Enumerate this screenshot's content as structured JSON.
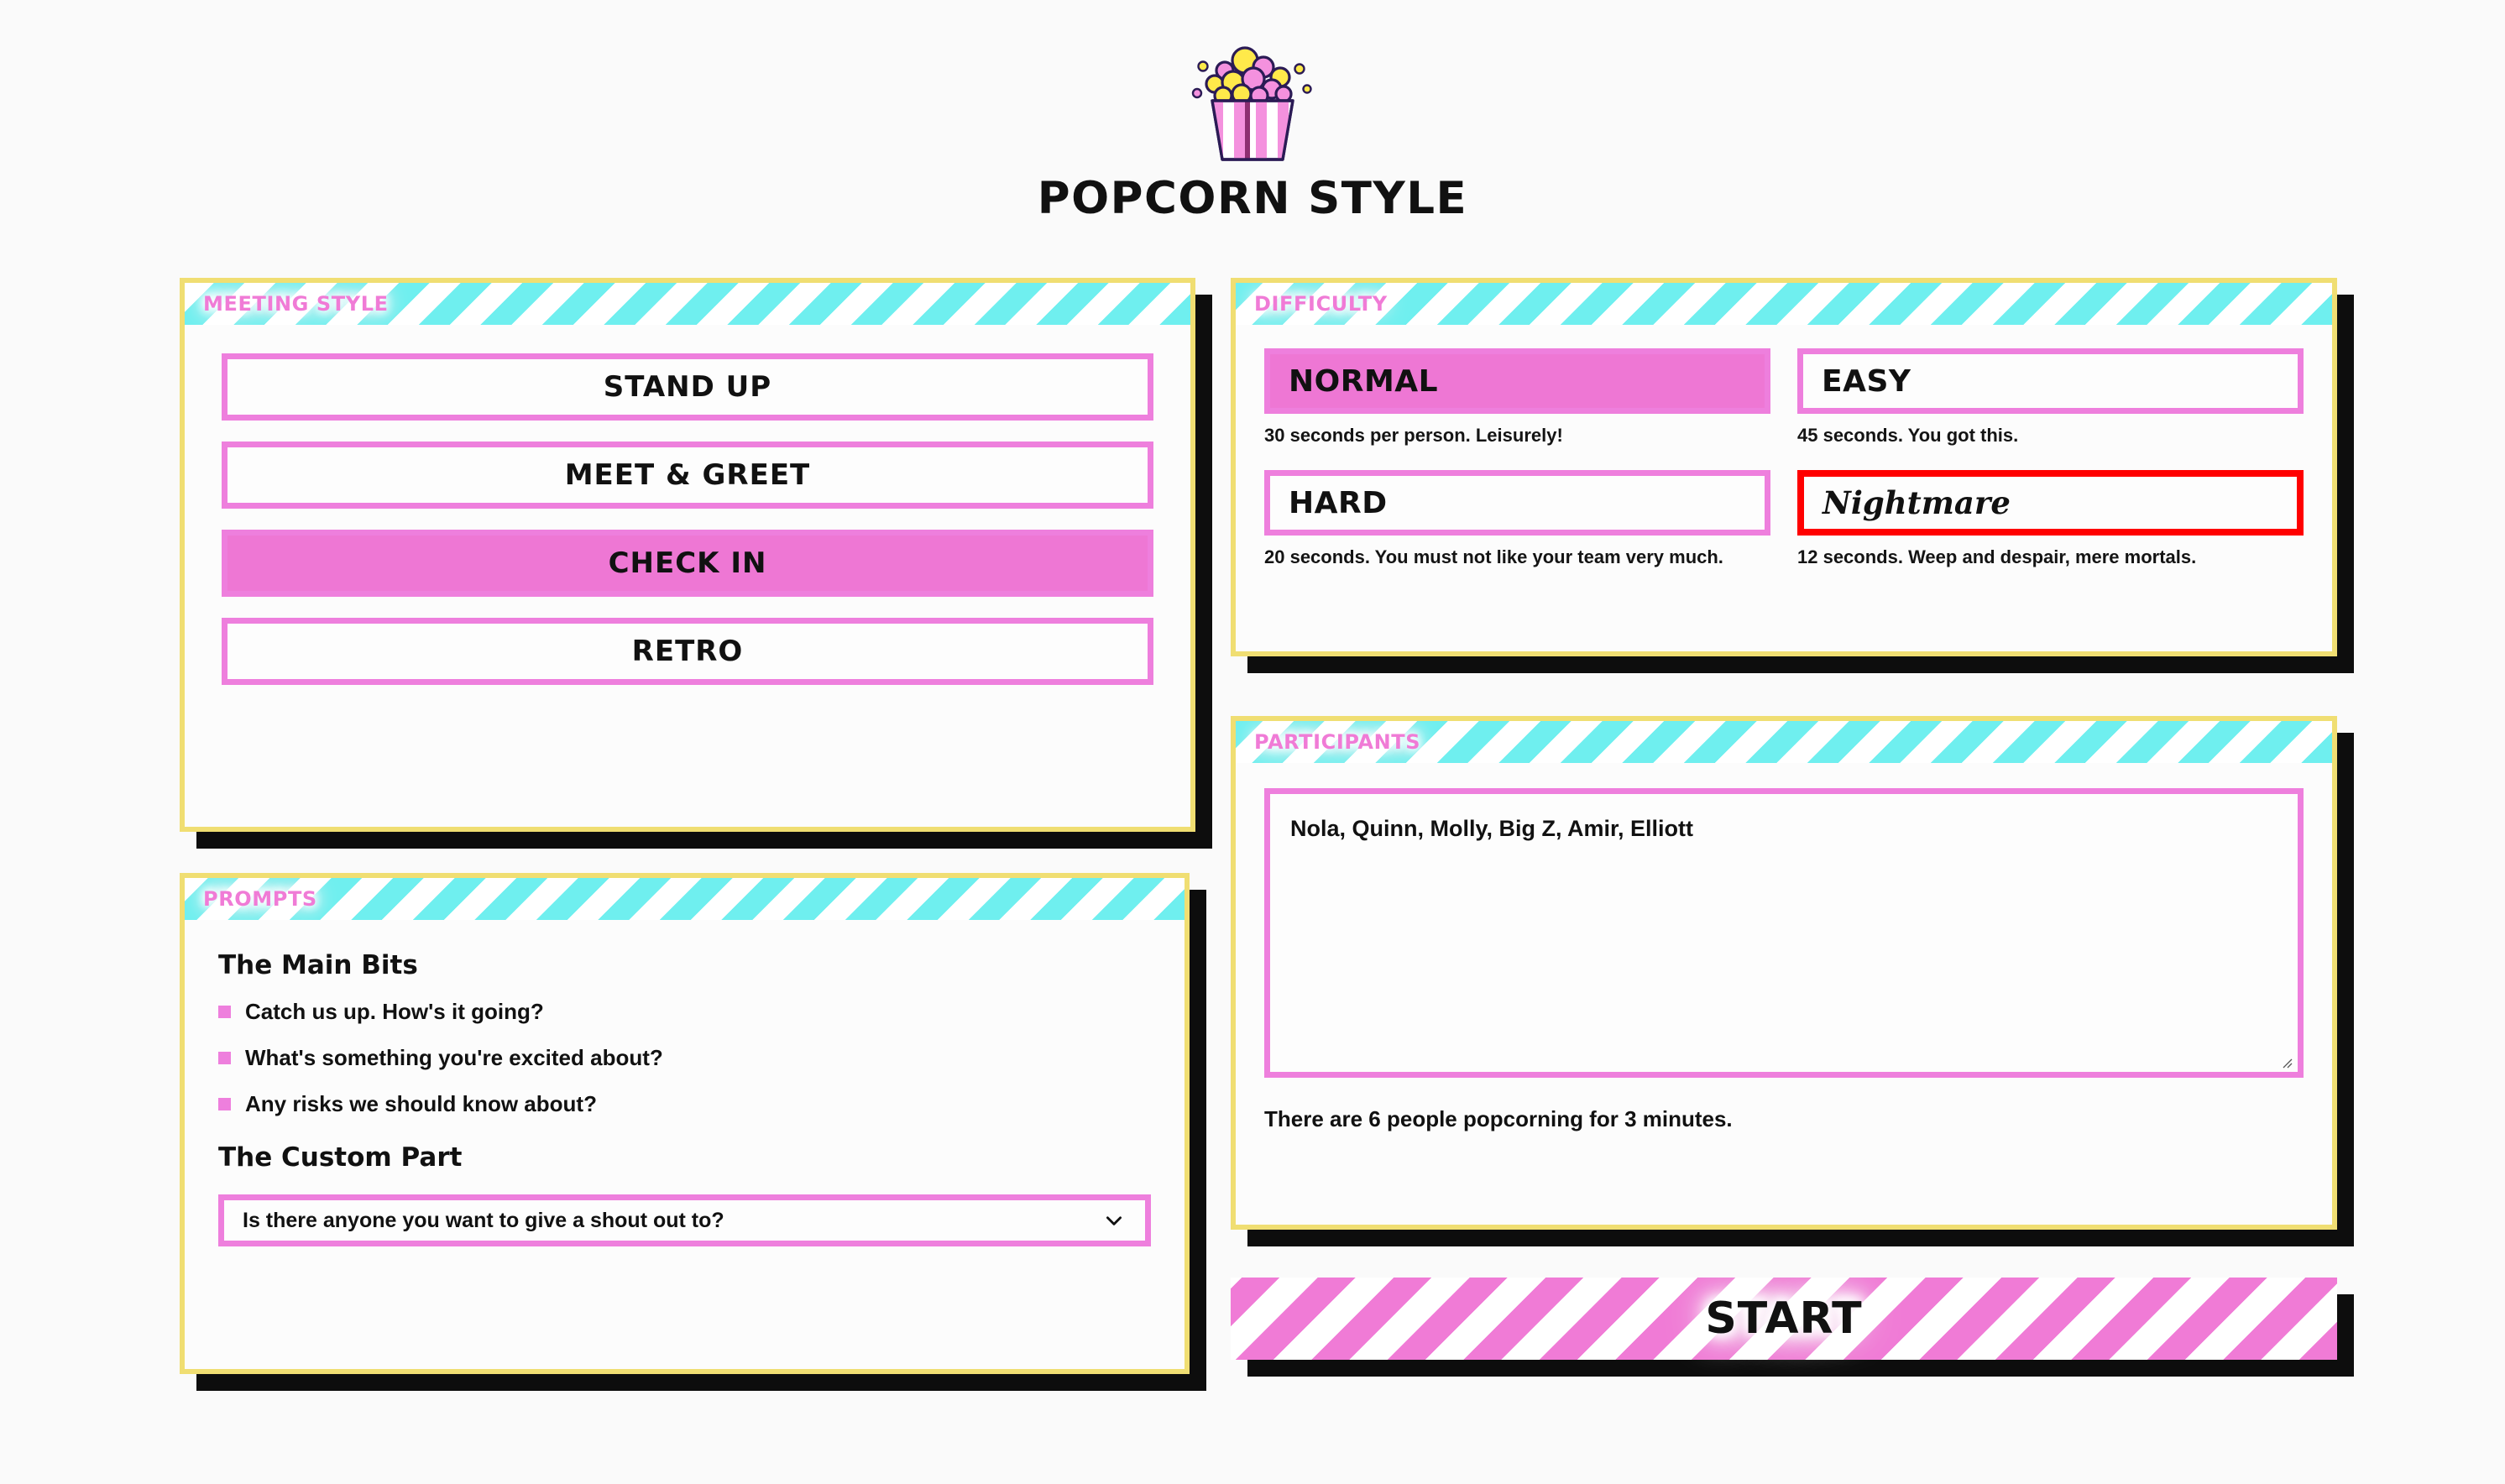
{
  "brand": {
    "title": "POPCORN STYLE",
    "logo_icon": "popcorn-bucket-icon"
  },
  "meeting_style": {
    "panel_title": "MEETING STYLE",
    "options": [
      {
        "label": "STAND UP",
        "selected": false
      },
      {
        "label": "MEET & GREET",
        "selected": false
      },
      {
        "label": "CHECK IN",
        "selected": true
      },
      {
        "label": "RETRO",
        "selected": false
      }
    ]
  },
  "prompts": {
    "panel_title": "PROMPTS",
    "main_heading": "The Main Bits",
    "items": [
      "Catch us up. How's it going?",
      "What's something you're excited about?",
      "Any risks we should know about?"
    ],
    "custom_heading": "The Custom Part",
    "custom_select": {
      "value": "Is there anyone you want to give a shout out to?",
      "chevron_icon": "chevron-down-icon"
    }
  },
  "difficulty": {
    "panel_title": "DIFFICULTY",
    "options": [
      {
        "label": "NORMAL",
        "note": "30 seconds per person. Leisurely!",
        "selected": true,
        "style": "normal"
      },
      {
        "label": "EASY",
        "note": "45 seconds. You got this.",
        "selected": false,
        "style": "normal"
      },
      {
        "label": "HARD",
        "note": "20 seconds. You must not like your team very much.",
        "selected": false,
        "style": "normal"
      },
      {
        "label": "Nightmare",
        "note": "12 seconds. Weep and despair, mere mortals.",
        "selected": false,
        "style": "gothic-danger"
      }
    ]
  },
  "participants": {
    "panel_title": "PARTICIPANTS",
    "names_value": "Nola, Quinn, Molly, Big Z, Amir, Elliott",
    "names_placeholder": "Nola, Quinn, Molly, Big Z, Amir, Elliott",
    "summary": "There are 6 people popcorning for 3 minutes.",
    "resize_icon": "resize-grip-icon"
  },
  "start": {
    "label": "START"
  },
  "colors": {
    "page_background": "#FAFAFA",
    "panel_border_yellow": "#F0DE72",
    "shadow_black": "#0D0D0D",
    "accent_pink": "#EE7FDD",
    "selected_pink": "#EE77D4",
    "stripe_cyan": "#6FEFEF",
    "danger_red": "#FF0000",
    "text_black": "#111111"
  }
}
